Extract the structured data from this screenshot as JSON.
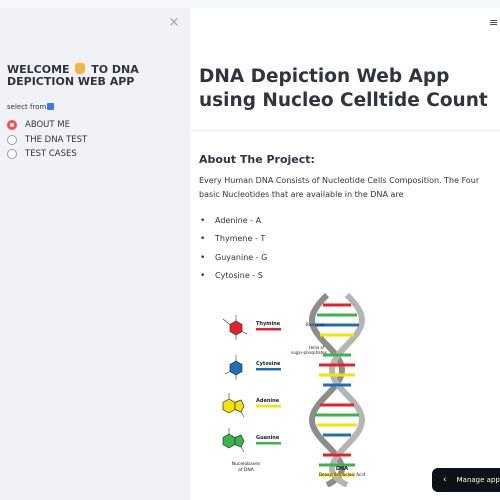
{
  "sidebar": {
    "close_glyph": "×",
    "welcome_before": "WELCOME",
    "welcome_after": "TO DNA DEPICTION WEB APP",
    "radio_label": "select from",
    "options": [
      {
        "label": "ABOUT ME",
        "selected": true
      },
      {
        "label": "THE DNA TEST",
        "selected": false
      },
      {
        "label": "TEST CASES",
        "selected": false
      }
    ]
  },
  "header": {
    "menu_glyph": "≡"
  },
  "main": {
    "title": "DNA Depiction Web App using Nucleo Celltide Count",
    "section_heading": "About The Project:",
    "description": "Every Human DNA Consists of Nucleotide Cells Composition. The Four basic Nucleotides that are available in the DNA are",
    "nucleotides": [
      "Adenine - A",
      "Thymene - T",
      "Guyanine - G",
      "Cytosine - S"
    ]
  },
  "figure": {
    "labels": {
      "thymine": "Thymine",
      "cytosine": "Cytosine",
      "adenine": "Adenine",
      "guanine": "Guanine",
      "nucleobases": "Nucelobases",
      "of_dna": "of DNA",
      "base_pair": "Base pair",
      "helix": "Helix of",
      "sugar_phosphates": "sugar-phosphates",
      "dna": "DNA",
      "dna_full": "Deoxyribonucleic Acid"
    },
    "colors": {
      "thymine": "#e8202a",
      "cytosine": "#1f6fb5",
      "adenine": "#f5e400",
      "guanine": "#39b54a",
      "backbone": "#9a9a9a"
    }
  },
  "footer": {
    "manage_label": "Manage app"
  },
  "theme": {
    "accent": "#ff4b4b",
    "sidebar_bg": "#f0f2f6",
    "text": "#31333f"
  }
}
